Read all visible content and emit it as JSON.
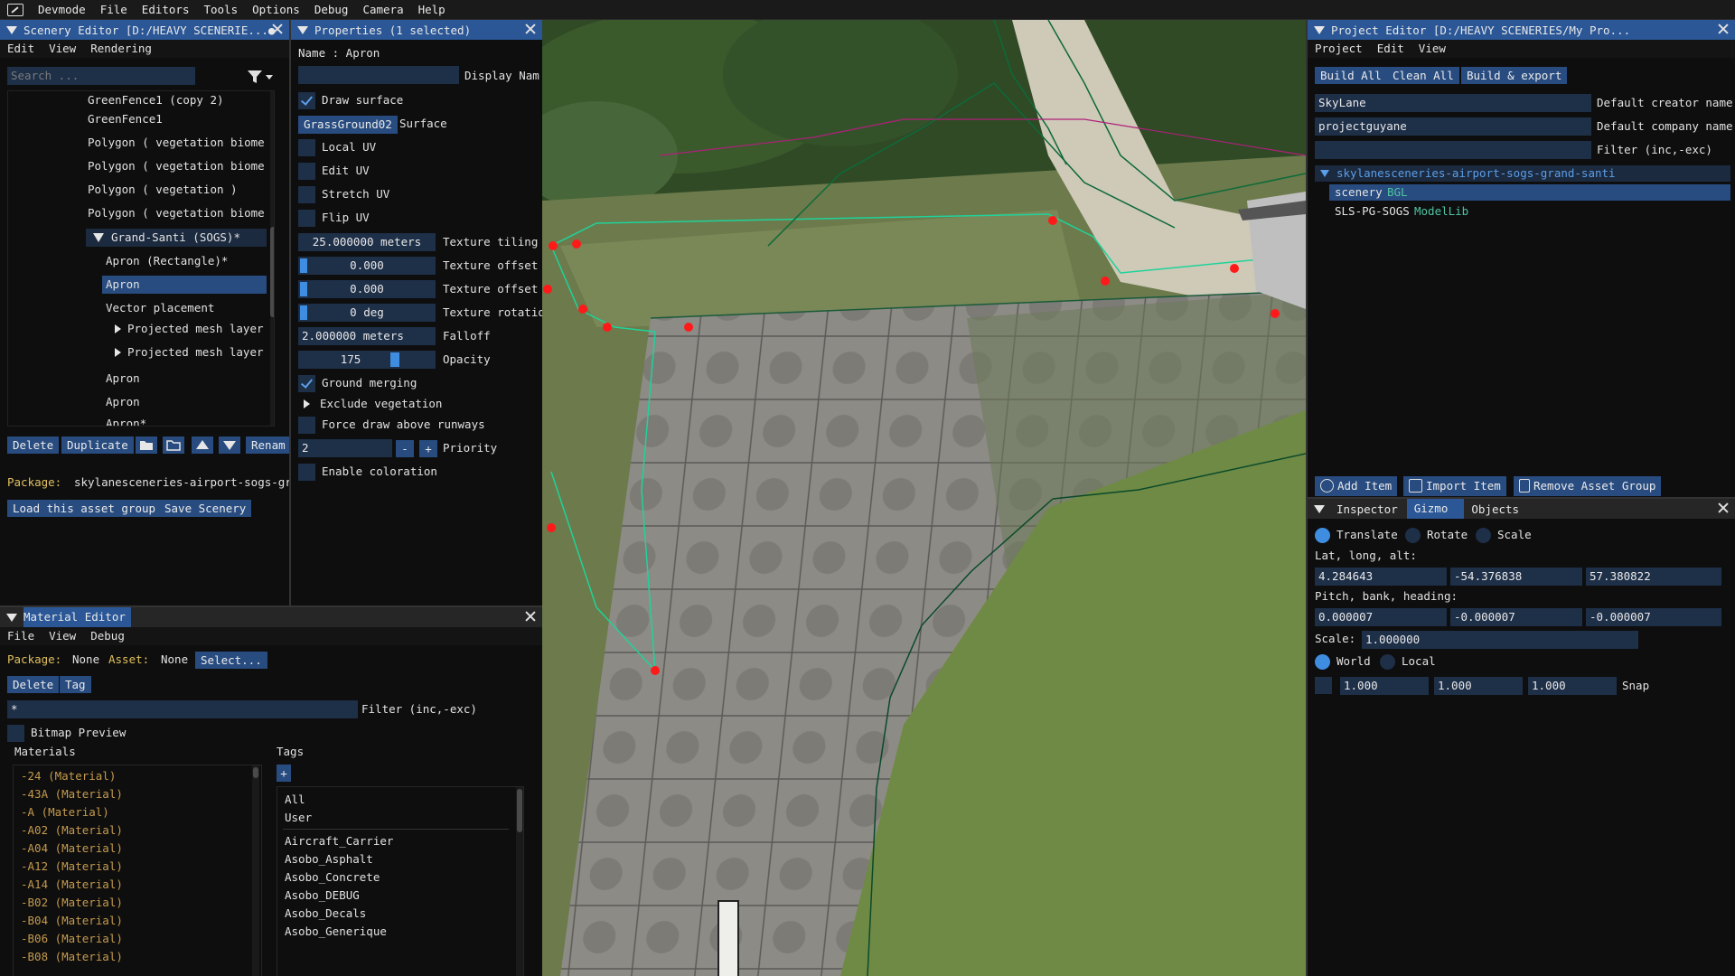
{
  "menubar": {
    "items": [
      "Devmode",
      "File",
      "Editors",
      "Tools",
      "Options",
      "Debug",
      "Camera",
      "Help"
    ]
  },
  "scenery_editor": {
    "title": "Scenery Editor [D:/HEAVY SCENERIE...●",
    "menu": [
      "Edit",
      "View",
      "Rendering"
    ],
    "search_placeholder": "Search ...",
    "tree": [
      {
        "label": "GreenFence1 (copy 2)",
        "indent": 0
      },
      {
        "label": "GreenFence1",
        "indent": 0
      },
      {
        "label": "Polygon  ( vegetation biome",
        "indent": 0
      },
      {
        "label": "Polygon  ( vegetation biome",
        "indent": 0
      },
      {
        "label": "Polygon  ( vegetation )",
        "indent": 0
      },
      {
        "label": "Polygon  ( vegetation biome",
        "indent": 0
      },
      {
        "label": "Grand-Santi (SOGS)*",
        "indent": 0
      },
      {
        "label": "Apron (Rectangle)*",
        "indent": 1
      },
      {
        "label": "Apron",
        "indent": 1
      },
      {
        "label": "Vector placement",
        "indent": 1
      },
      {
        "label": "Projected mesh layer",
        "indent": 2
      },
      {
        "label": "Projected mesh layer",
        "indent": 2
      },
      {
        "label": "Apron",
        "indent": 1
      },
      {
        "label": "Apron",
        "indent": 1
      },
      {
        "label": "Apron*",
        "indent": 1
      }
    ],
    "buttons": {
      "delete": "Delete",
      "duplicate": "Duplicate",
      "rename": "Renam"
    },
    "package_label": "Package:",
    "package_value": "skylanesceneries-airport-sogs-gr",
    "load_btn": "Load this asset group",
    "save_btn": "Save Scenery"
  },
  "properties": {
    "title": "Properties (1 selected)",
    "name_line": "Name : Apron",
    "display_name_label": "Display Nam",
    "display_name_value": "",
    "draw_surface": "Draw surface",
    "surface_value": "GrassGround02",
    "surface_label": "Surface",
    "local_uv": "Local UV",
    "edit_uv": "Edit UV",
    "stretch_uv": "Stretch UV",
    "flip_uv": "Flip UV",
    "texture_tiling_value": "25.000000 meters",
    "texture_tiling_label": "Texture tiling",
    "texture_offset1_value": "0.000",
    "texture_offset2_value": "0.000",
    "texture_offset_label": "Texture offset",
    "texture_rotation_value": "0 deg",
    "texture_rotation_label": "Texture rotatio",
    "falloff_value": "2.000000 meters",
    "falloff_label": "Falloff",
    "opacity_value": "175",
    "opacity_label": "Opacity",
    "ground_merging": "Ground merging",
    "exclude_vegetation": "Exclude vegetation",
    "force_draw": "Force draw above runways",
    "priority_value": "2",
    "priority_minus": "-",
    "priority_plus": "+",
    "priority_label": "Priority",
    "enable_coloration": "Enable coloration"
  },
  "material_editor": {
    "title": "Material Editor",
    "menu": [
      "File",
      "View",
      "Debug"
    ],
    "package_label": "Package:",
    "package_value": "None",
    "asset_label": "Asset:",
    "asset_value": "None",
    "select_btn": "Select...",
    "delete_btn": "Delete",
    "tag_btn": "Tag",
    "filter_value": "*",
    "filter_label": "Filter (inc,-exc)",
    "bitmap_preview": "Bitmap Preview",
    "materials_header": "Materials",
    "tags_header": "Tags",
    "tags_add": "+",
    "materials": [
      "-24 (Material)",
      "-43A (Material)",
      "-A (Material)",
      "-A02 (Material)",
      "-A04 (Material)",
      "-A12 (Material)",
      "-A14 (Material)",
      "-B02 (Material)",
      "-B04 (Material)",
      "-B06 (Material)",
      "-B08 (Material)"
    ],
    "tags_top": [
      "All",
      "User"
    ],
    "tags": [
      "Aircraft_Carrier",
      "Asobo_Asphalt",
      "Asobo_Concrete",
      "Asobo_DEBUG",
      "Asobo_Decals",
      "Asobo_Generique"
    ]
  },
  "project_editor": {
    "title": "Project Editor [D:/HEAVY SCENERIES/My Pro...",
    "menu": [
      "Project",
      "Edit",
      "View"
    ],
    "build_all": "Build All",
    "clean_all": "Clean All",
    "build_export": "Build & export",
    "creator_value": "SkyLane",
    "creator_label": "Default creator name",
    "company_value": "projectguyane",
    "company_label": "Default company name",
    "filter_value": "",
    "filter_label": "Filter (inc,-exc)",
    "tree_root": "skylanesceneries-airport-sogs-grand-santi",
    "items": [
      {
        "name": "scenery",
        "type": "BGL"
      },
      {
        "name": "SLS-PG-SOGS",
        "type": "ModelLib"
      }
    ],
    "add_item": "Add Item",
    "import_item": "Import Item",
    "remove_group": "Remove Asset Group"
  },
  "inspector": {
    "tabs": [
      "Inspector",
      "Gizmo",
      "Objects"
    ],
    "translate": "Translate",
    "rotate": "Rotate",
    "scale": "Scale",
    "lla_label": "Lat, long, alt:",
    "lat": "4.284643",
    "lon": "-54.376838",
    "alt": "57.380822",
    "pbh_label": "Pitch, bank, heading:",
    "pitch": "0.000007",
    "bank": "-0.000007",
    "heading": "-0.000007",
    "scale_label": "Scale:",
    "scale_value": "1.000000",
    "world": "World",
    "local": "Local",
    "snap1": "1.000",
    "snap2": "1.000",
    "snap3": "1.000",
    "snap_label": "Snap"
  },
  "colors": {
    "accent": "#2b5797",
    "button": "#284c80",
    "field": "#1e2f48",
    "material_text": "#c49a4e",
    "bgl": "#4fc3a0",
    "red_point": "#ff1a1a"
  }
}
